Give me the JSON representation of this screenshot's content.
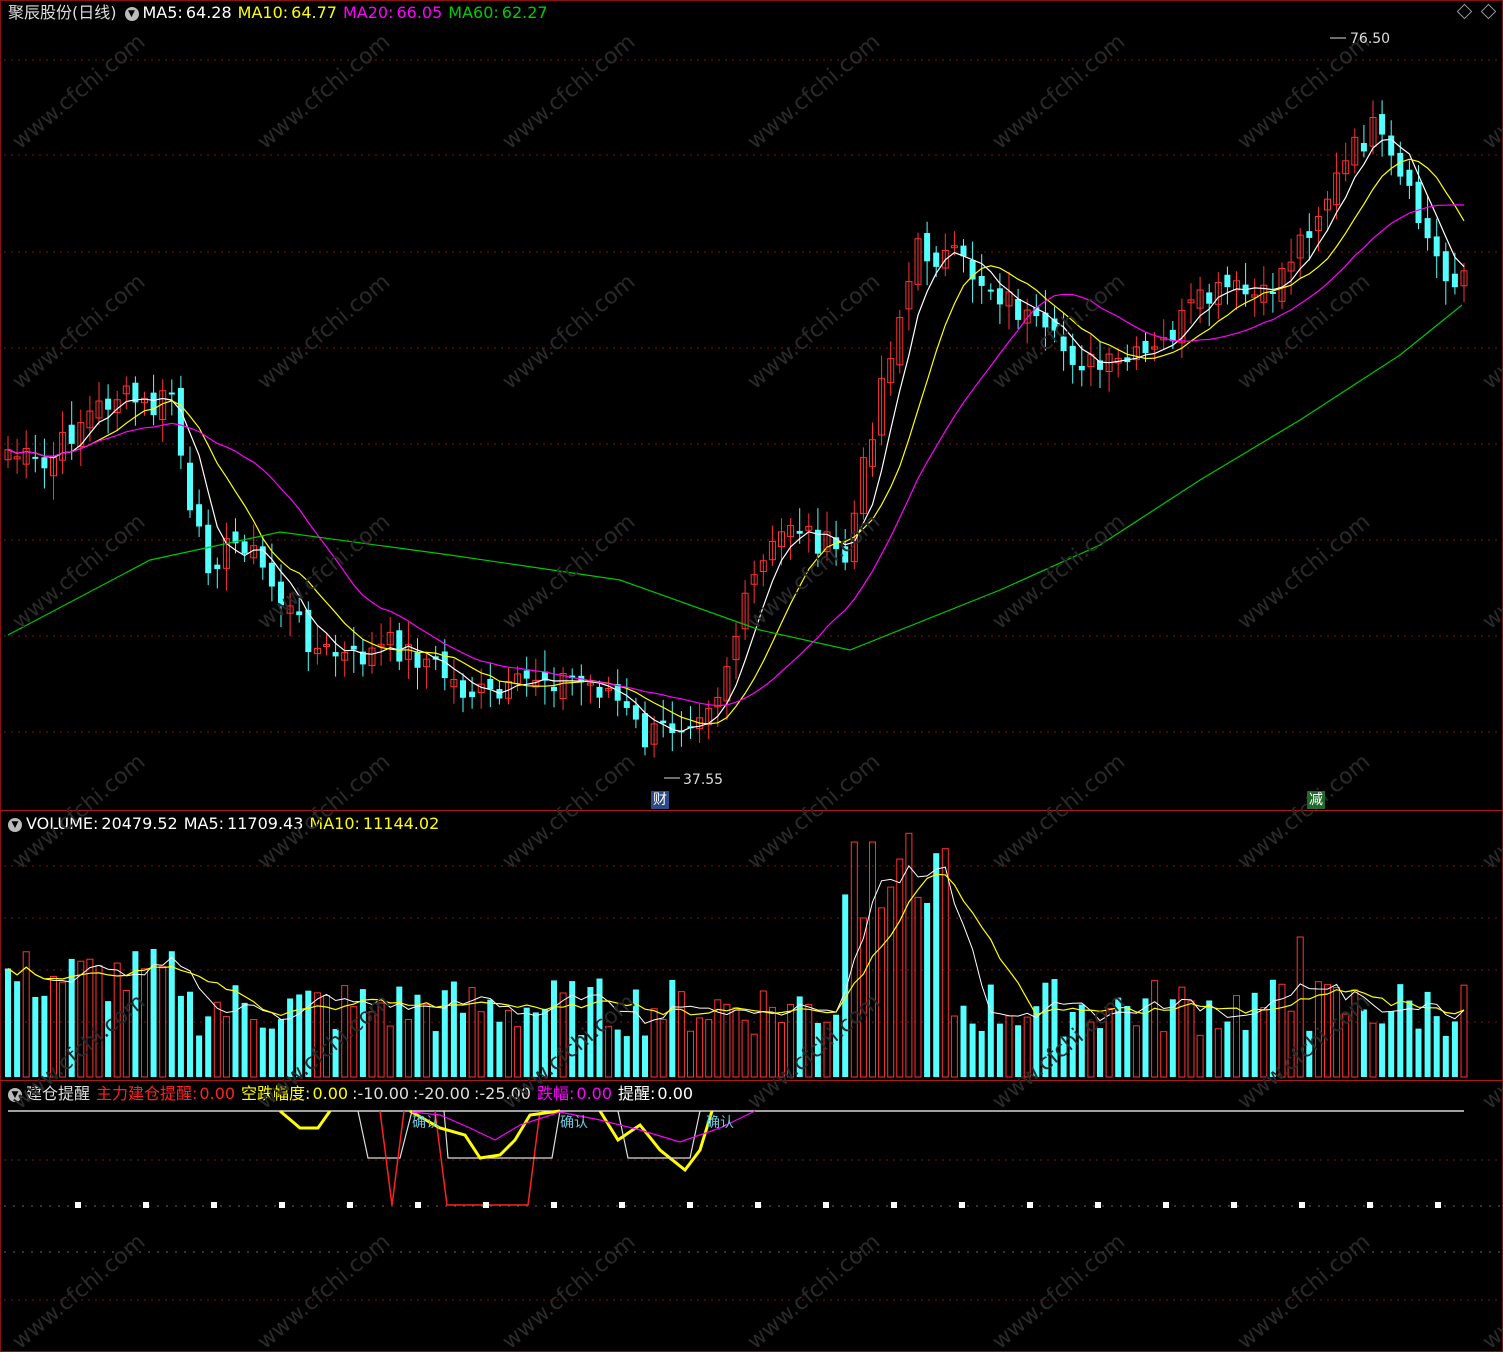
{
  "price_panel": {
    "title": "聚辰股份(日线)",
    "ma5_label": "MA5:",
    "ma5_value": "64.28",
    "ma10_label": "MA10:",
    "ma10_value": "64.77",
    "ma20_label": "MA20:",
    "ma20_value": "66.05",
    "ma60_label": "MA60:",
    "ma60_value": "62.27",
    "high_mark": "76.50",
    "low_mark": "37.55",
    "event_marks": [
      "财",
      "减"
    ]
  },
  "volume_panel": {
    "label": "VOLUME:",
    "value": "20479.52",
    "ma5_label": "MA5:",
    "ma5_value": "11709.43",
    "ma10_label": "MA10:",
    "ma10_value": "11144.02"
  },
  "indicator_panel": {
    "name": "建仓提醒",
    "main_label": "主力建仓提醒:",
    "main_value": "0.00",
    "drop_label": "空跌幅度:",
    "drop_value": "0.00",
    "level1": ":-10.00",
    "level2": ":-20.00",
    "level3": ":-25.00",
    "fall_label": "跌幅:",
    "fall_value": "0.00",
    "remind_label": "提醒:",
    "remind_value": "0.00",
    "confirm_tags": [
      "确认",
      "确认",
      "确认"
    ]
  },
  "colors": {
    "up": "#ff3232",
    "down": "#54ffff",
    "ma5": "#ffffff",
    "ma10": "#ffff00",
    "ma20": "#ff00ff",
    "ma60": "#00c800",
    "grid": "#8a1010",
    "indicator_red": "#ff2020"
  },
  "chart_data": [
    {
      "type": "candlestick",
      "title": "聚辰股份(日线)",
      "y_range": [
        37.55,
        76.5
      ],
      "high_label": 76.5,
      "low_label": 37.55,
      "series": [
        {
          "name": "MA5",
          "value": 64.28
        },
        {
          "name": "MA10",
          "value": 64.77
        },
        {
          "name": "MA20",
          "value": 66.05
        },
        {
          "name": "MA60",
          "value": 62.27
        }
      ]
    },
    {
      "type": "bar",
      "title": "VOLUME",
      "series": [
        {
          "name": "VOLUME",
          "value": 20479.52
        },
        {
          "name": "MA5",
          "value": 11709.43
        },
        {
          "name": "MA10",
          "value": 11144.02
        }
      ]
    },
    {
      "type": "line",
      "title": "建仓提醒",
      "series": [
        {
          "name": "主力建仓提醒",
          "value": 0.0
        },
        {
          "name": "空跌幅度",
          "value": 0.0
        },
        {
          "name": "跌幅",
          "value": 0.0
        },
        {
          "name": "提醒",
          "value": 0.0
        }
      ],
      "levels": [
        -10.0,
        -20.0,
        -25.0
      ]
    }
  ]
}
